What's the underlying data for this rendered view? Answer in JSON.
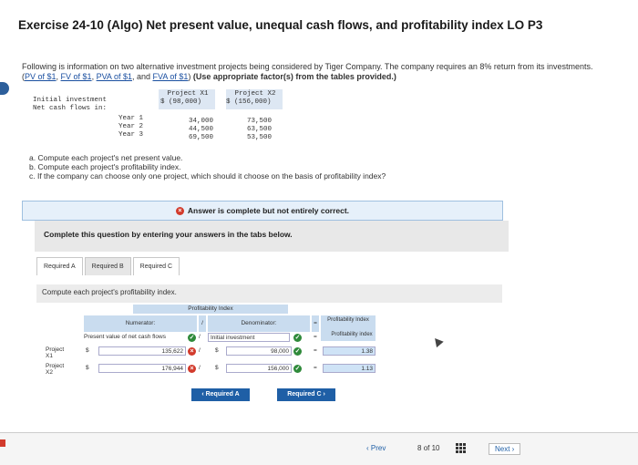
{
  "title": "Exercise 24-10 (Algo) Net present value, unequal cash flows, and profitability index LO P3",
  "intro": {
    "text_before": "Following is information on two alternative investment projects being considered by Tiger Company. The company requires an 8% return from its investments. (",
    "links": [
      "PV of $1",
      "FV of $1",
      "PVA of $1",
      "FVA of $1"
    ],
    "sep1": ", ",
    "and": ", and ",
    "close": ")",
    "bold": "(Use appropriate factor(s) from the tables provided.)"
  },
  "project_table": {
    "headers": [
      "Project X1",
      "Project X2"
    ],
    "rows": [
      {
        "label": "Initial investment",
        "x1": "$ (98,000)",
        "x2": "$ (156,000)"
      },
      {
        "label": "Net cash flows in:",
        "x1": "",
        "x2": ""
      },
      {
        "label": "Year 1",
        "x1": "34,000",
        "x2": "73,500"
      },
      {
        "label": "Year 2",
        "x1": "44,500",
        "x2": "63,500"
      },
      {
        "label": "Year 3",
        "x1": "69,500",
        "x2": "53,500"
      }
    ]
  },
  "questions": [
    "a. Compute each project's net present value.",
    "b. Compute each project's profitability index.",
    "c. If the company can choose only one project, which should it choose on the basis of profitability index?"
  ],
  "answer_status": "Answer is complete but not entirely correct.",
  "complete_instruction": "Complete this question by entering your answers in the tabs below.",
  "tabs": [
    "Required A",
    "Required B",
    "Required C"
  ],
  "compute_label": "Compute each project's profitability index.",
  "pi_table": {
    "title": "Profitability Index",
    "numerator": "Numerator:",
    "slash": "/",
    "denominator": "Denominator:",
    "eq": "=",
    "result_header": "Profitability Index",
    "num_desc": "Present value of net cash flows",
    "den_desc": "Initial investment",
    "res_desc": "Profitability index",
    "rows": [
      {
        "label": "Project X1",
        "dollar": "$",
        "num": "135,622",
        "den": "98,000",
        "res": "1.38"
      },
      {
        "label": "Project X2",
        "dollar": "$",
        "num": "176,944",
        "den": "156,000",
        "res": "1.13"
      }
    ]
  },
  "buttons": {
    "prev_req": "Required A",
    "next_req": "Required C"
  },
  "footer": {
    "prev": "Prev",
    "page": "8",
    "of": "of",
    "total": "10",
    "next": "Next"
  },
  "colors": {
    "accent": "#1f5fa6",
    "error": "#d23b2c",
    "ok": "#2f8a3a"
  }
}
